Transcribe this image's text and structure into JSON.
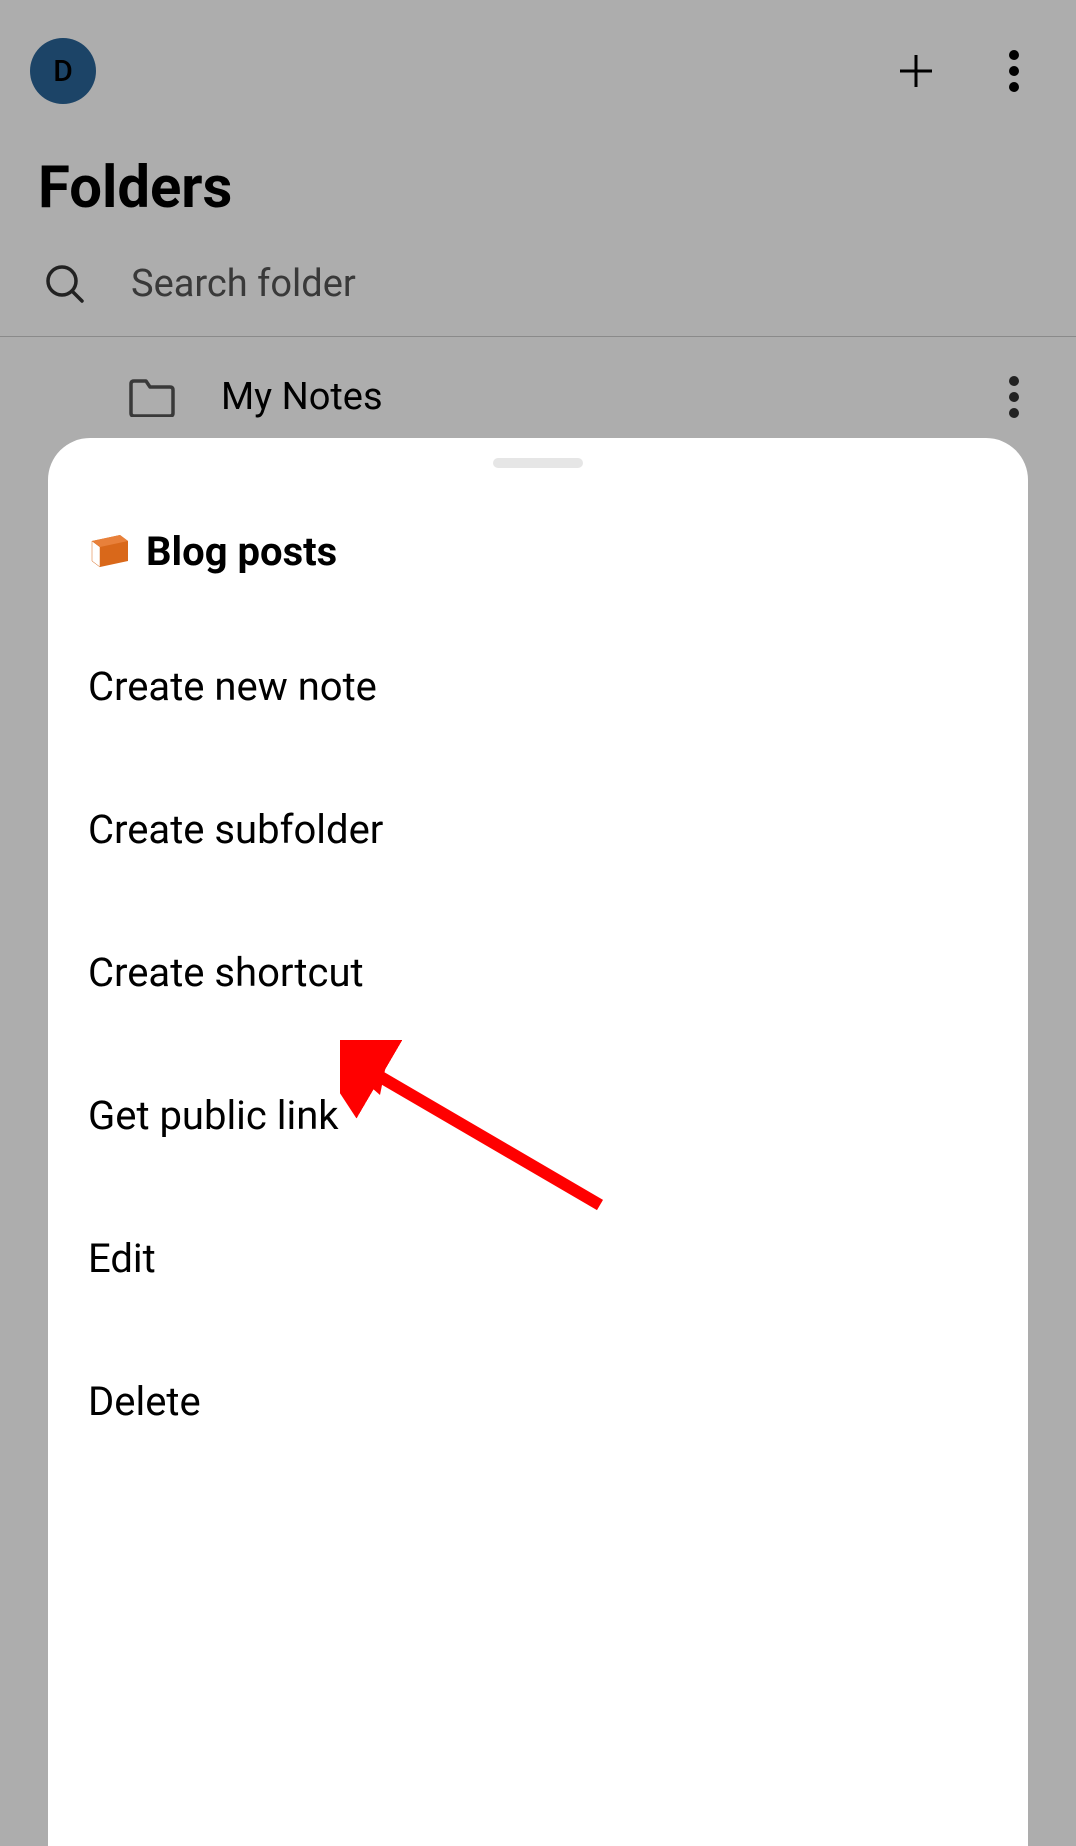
{
  "header": {
    "avatar_letter": "D"
  },
  "page_title": "Folders",
  "search": {
    "placeholder": "Search folder"
  },
  "folder_list": {
    "items": [
      {
        "name": "My Notes"
      }
    ]
  },
  "sheet": {
    "context_folder": "Blog posts",
    "icon": "book-icon",
    "menu": [
      {
        "label": "Create new note"
      },
      {
        "label": "Create subfolder"
      },
      {
        "label": "Create shortcut"
      },
      {
        "label": "Get public link"
      },
      {
        "label": "Edit"
      },
      {
        "label": "Delete"
      }
    ]
  }
}
